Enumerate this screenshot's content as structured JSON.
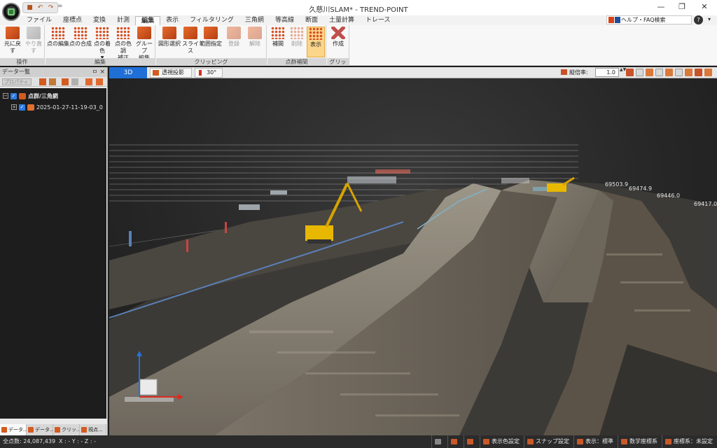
{
  "window": {
    "title": "久慈川SLAM* - TREND-POINT",
    "qat_more": "="
  },
  "menu": {
    "tabs": [
      "ファイル",
      "座標点",
      "変換",
      "計測",
      "編集",
      "表示",
      "フィルタリング",
      "三角網",
      "等高線",
      "断面",
      "土量計算",
      "トレース"
    ],
    "active_tab": "編集",
    "help_search": "ヘルプ・FAQ検索",
    "help_button": "?"
  },
  "ribbon": {
    "groups": {
      "operation": "操作",
      "edit": "編集",
      "clipping": "クリッピング",
      "point_cloud_interpolation": "点群補間",
      "grid": "グリッド"
    },
    "buttons": {
      "undo": "元に戻す",
      "redo": "やり直す",
      "point_edit": "点の編集",
      "point_merge": "点の合成",
      "point_color": "点の着色",
      "color_correct_1": "点の色調",
      "color_correct_2": "補正",
      "group_edit_1": "グループ",
      "group_edit_2": "編集",
      "shape_select": "図形選択",
      "slice": "スライス",
      "range_specify": "範囲指定",
      "register": "登録",
      "release": "解除",
      "interpolate": "補間",
      "delete": "削除",
      "display": "表示",
      "create": "作成"
    }
  },
  "panel": {
    "title": "データ一覧",
    "pin": "ㅁ",
    "close": "×",
    "properties": "プロパティ",
    "tree": [
      {
        "label": "点群/三角網",
        "expander": "−"
      },
      {
        "label": "2025-01-27-11-19-03_0",
        "expander": "+"
      }
    ],
    "tabs": [
      "データ...",
      "データ...",
      "クリッ...",
      "視点..."
    ]
  },
  "viewport_toolbar": {
    "mode_3d": "3D",
    "perspective": "透視投影",
    "fov": "30°",
    "scale_label": "縦倍率:",
    "scale_value": "1.0",
    "spin": "▲▼"
  },
  "grid_labels": [
    "69503.9",
    "69474.9",
    "69446.0",
    "69417.0"
  ],
  "status": {
    "point_count": "全点数: 24,087,439",
    "xyz": "X : -  Y : -  Z : -",
    "buttons": [
      "",
      "",
      "",
      "表示色設定",
      "スナップ設定",
      "表示：標準",
      "数学座標系",
      "座標系：未設定"
    ]
  },
  "colors": {
    "accent_blue": "#1f6fd6",
    "brand_orange": "#d45b1f",
    "excavator_yellow": "#e8b800"
  },
  "icons": {
    "undo": "undo-icon",
    "redo": "redo-icon",
    "point_cloud": "point-cloud-icon",
    "grid": "grid-icon"
  }
}
